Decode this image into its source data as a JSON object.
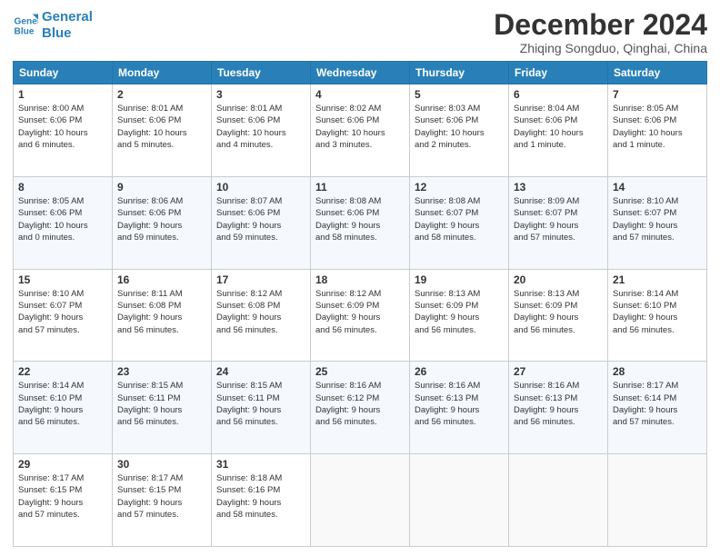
{
  "logo": {
    "line1": "General",
    "line2": "Blue"
  },
  "title": {
    "month": "December 2024",
    "location": "Zhiqing Songduo, Qinghai, China"
  },
  "headers": [
    "Sunday",
    "Monday",
    "Tuesday",
    "Wednesday",
    "Thursday",
    "Friday",
    "Saturday"
  ],
  "weeks": [
    [
      {
        "day": 1,
        "info": "Sunrise: 8:00 AM\nSunset: 6:06 PM\nDaylight: 10 hours\nand 6 minutes."
      },
      {
        "day": 2,
        "info": "Sunrise: 8:01 AM\nSunset: 6:06 PM\nDaylight: 10 hours\nand 5 minutes."
      },
      {
        "day": 3,
        "info": "Sunrise: 8:01 AM\nSunset: 6:06 PM\nDaylight: 10 hours\nand 4 minutes."
      },
      {
        "day": 4,
        "info": "Sunrise: 8:02 AM\nSunset: 6:06 PM\nDaylight: 10 hours\nand 3 minutes."
      },
      {
        "day": 5,
        "info": "Sunrise: 8:03 AM\nSunset: 6:06 PM\nDaylight: 10 hours\nand 2 minutes."
      },
      {
        "day": 6,
        "info": "Sunrise: 8:04 AM\nSunset: 6:06 PM\nDaylight: 10 hours\nand 1 minute."
      },
      {
        "day": 7,
        "info": "Sunrise: 8:05 AM\nSunset: 6:06 PM\nDaylight: 10 hours\nand 1 minute."
      }
    ],
    [
      {
        "day": 8,
        "info": "Sunrise: 8:05 AM\nSunset: 6:06 PM\nDaylight: 10 hours\nand 0 minutes."
      },
      {
        "day": 9,
        "info": "Sunrise: 8:06 AM\nSunset: 6:06 PM\nDaylight: 9 hours\nand 59 minutes."
      },
      {
        "day": 10,
        "info": "Sunrise: 8:07 AM\nSunset: 6:06 PM\nDaylight: 9 hours\nand 59 minutes."
      },
      {
        "day": 11,
        "info": "Sunrise: 8:08 AM\nSunset: 6:06 PM\nDaylight: 9 hours\nand 58 minutes."
      },
      {
        "day": 12,
        "info": "Sunrise: 8:08 AM\nSunset: 6:07 PM\nDaylight: 9 hours\nand 58 minutes."
      },
      {
        "day": 13,
        "info": "Sunrise: 8:09 AM\nSunset: 6:07 PM\nDaylight: 9 hours\nand 57 minutes."
      },
      {
        "day": 14,
        "info": "Sunrise: 8:10 AM\nSunset: 6:07 PM\nDaylight: 9 hours\nand 57 minutes."
      }
    ],
    [
      {
        "day": 15,
        "info": "Sunrise: 8:10 AM\nSunset: 6:07 PM\nDaylight: 9 hours\nand 57 minutes."
      },
      {
        "day": 16,
        "info": "Sunrise: 8:11 AM\nSunset: 6:08 PM\nDaylight: 9 hours\nand 56 minutes."
      },
      {
        "day": 17,
        "info": "Sunrise: 8:12 AM\nSunset: 6:08 PM\nDaylight: 9 hours\nand 56 minutes."
      },
      {
        "day": 18,
        "info": "Sunrise: 8:12 AM\nSunset: 6:09 PM\nDaylight: 9 hours\nand 56 minutes."
      },
      {
        "day": 19,
        "info": "Sunrise: 8:13 AM\nSunset: 6:09 PM\nDaylight: 9 hours\nand 56 minutes."
      },
      {
        "day": 20,
        "info": "Sunrise: 8:13 AM\nSunset: 6:09 PM\nDaylight: 9 hours\nand 56 minutes."
      },
      {
        "day": 21,
        "info": "Sunrise: 8:14 AM\nSunset: 6:10 PM\nDaylight: 9 hours\nand 56 minutes."
      }
    ],
    [
      {
        "day": 22,
        "info": "Sunrise: 8:14 AM\nSunset: 6:10 PM\nDaylight: 9 hours\nand 56 minutes."
      },
      {
        "day": 23,
        "info": "Sunrise: 8:15 AM\nSunset: 6:11 PM\nDaylight: 9 hours\nand 56 minutes."
      },
      {
        "day": 24,
        "info": "Sunrise: 8:15 AM\nSunset: 6:11 PM\nDaylight: 9 hours\nand 56 minutes."
      },
      {
        "day": 25,
        "info": "Sunrise: 8:16 AM\nSunset: 6:12 PM\nDaylight: 9 hours\nand 56 minutes."
      },
      {
        "day": 26,
        "info": "Sunrise: 8:16 AM\nSunset: 6:13 PM\nDaylight: 9 hours\nand 56 minutes."
      },
      {
        "day": 27,
        "info": "Sunrise: 8:16 AM\nSunset: 6:13 PM\nDaylight: 9 hours\nand 56 minutes."
      },
      {
        "day": 28,
        "info": "Sunrise: 8:17 AM\nSunset: 6:14 PM\nDaylight: 9 hours\nand 57 minutes."
      }
    ],
    [
      {
        "day": 29,
        "info": "Sunrise: 8:17 AM\nSunset: 6:15 PM\nDaylight: 9 hours\nand 57 minutes."
      },
      {
        "day": 30,
        "info": "Sunrise: 8:17 AM\nSunset: 6:15 PM\nDaylight: 9 hours\nand 57 minutes."
      },
      {
        "day": 31,
        "info": "Sunrise: 8:18 AM\nSunset: 6:16 PM\nDaylight: 9 hours\nand 58 minutes."
      },
      null,
      null,
      null,
      null
    ]
  ]
}
